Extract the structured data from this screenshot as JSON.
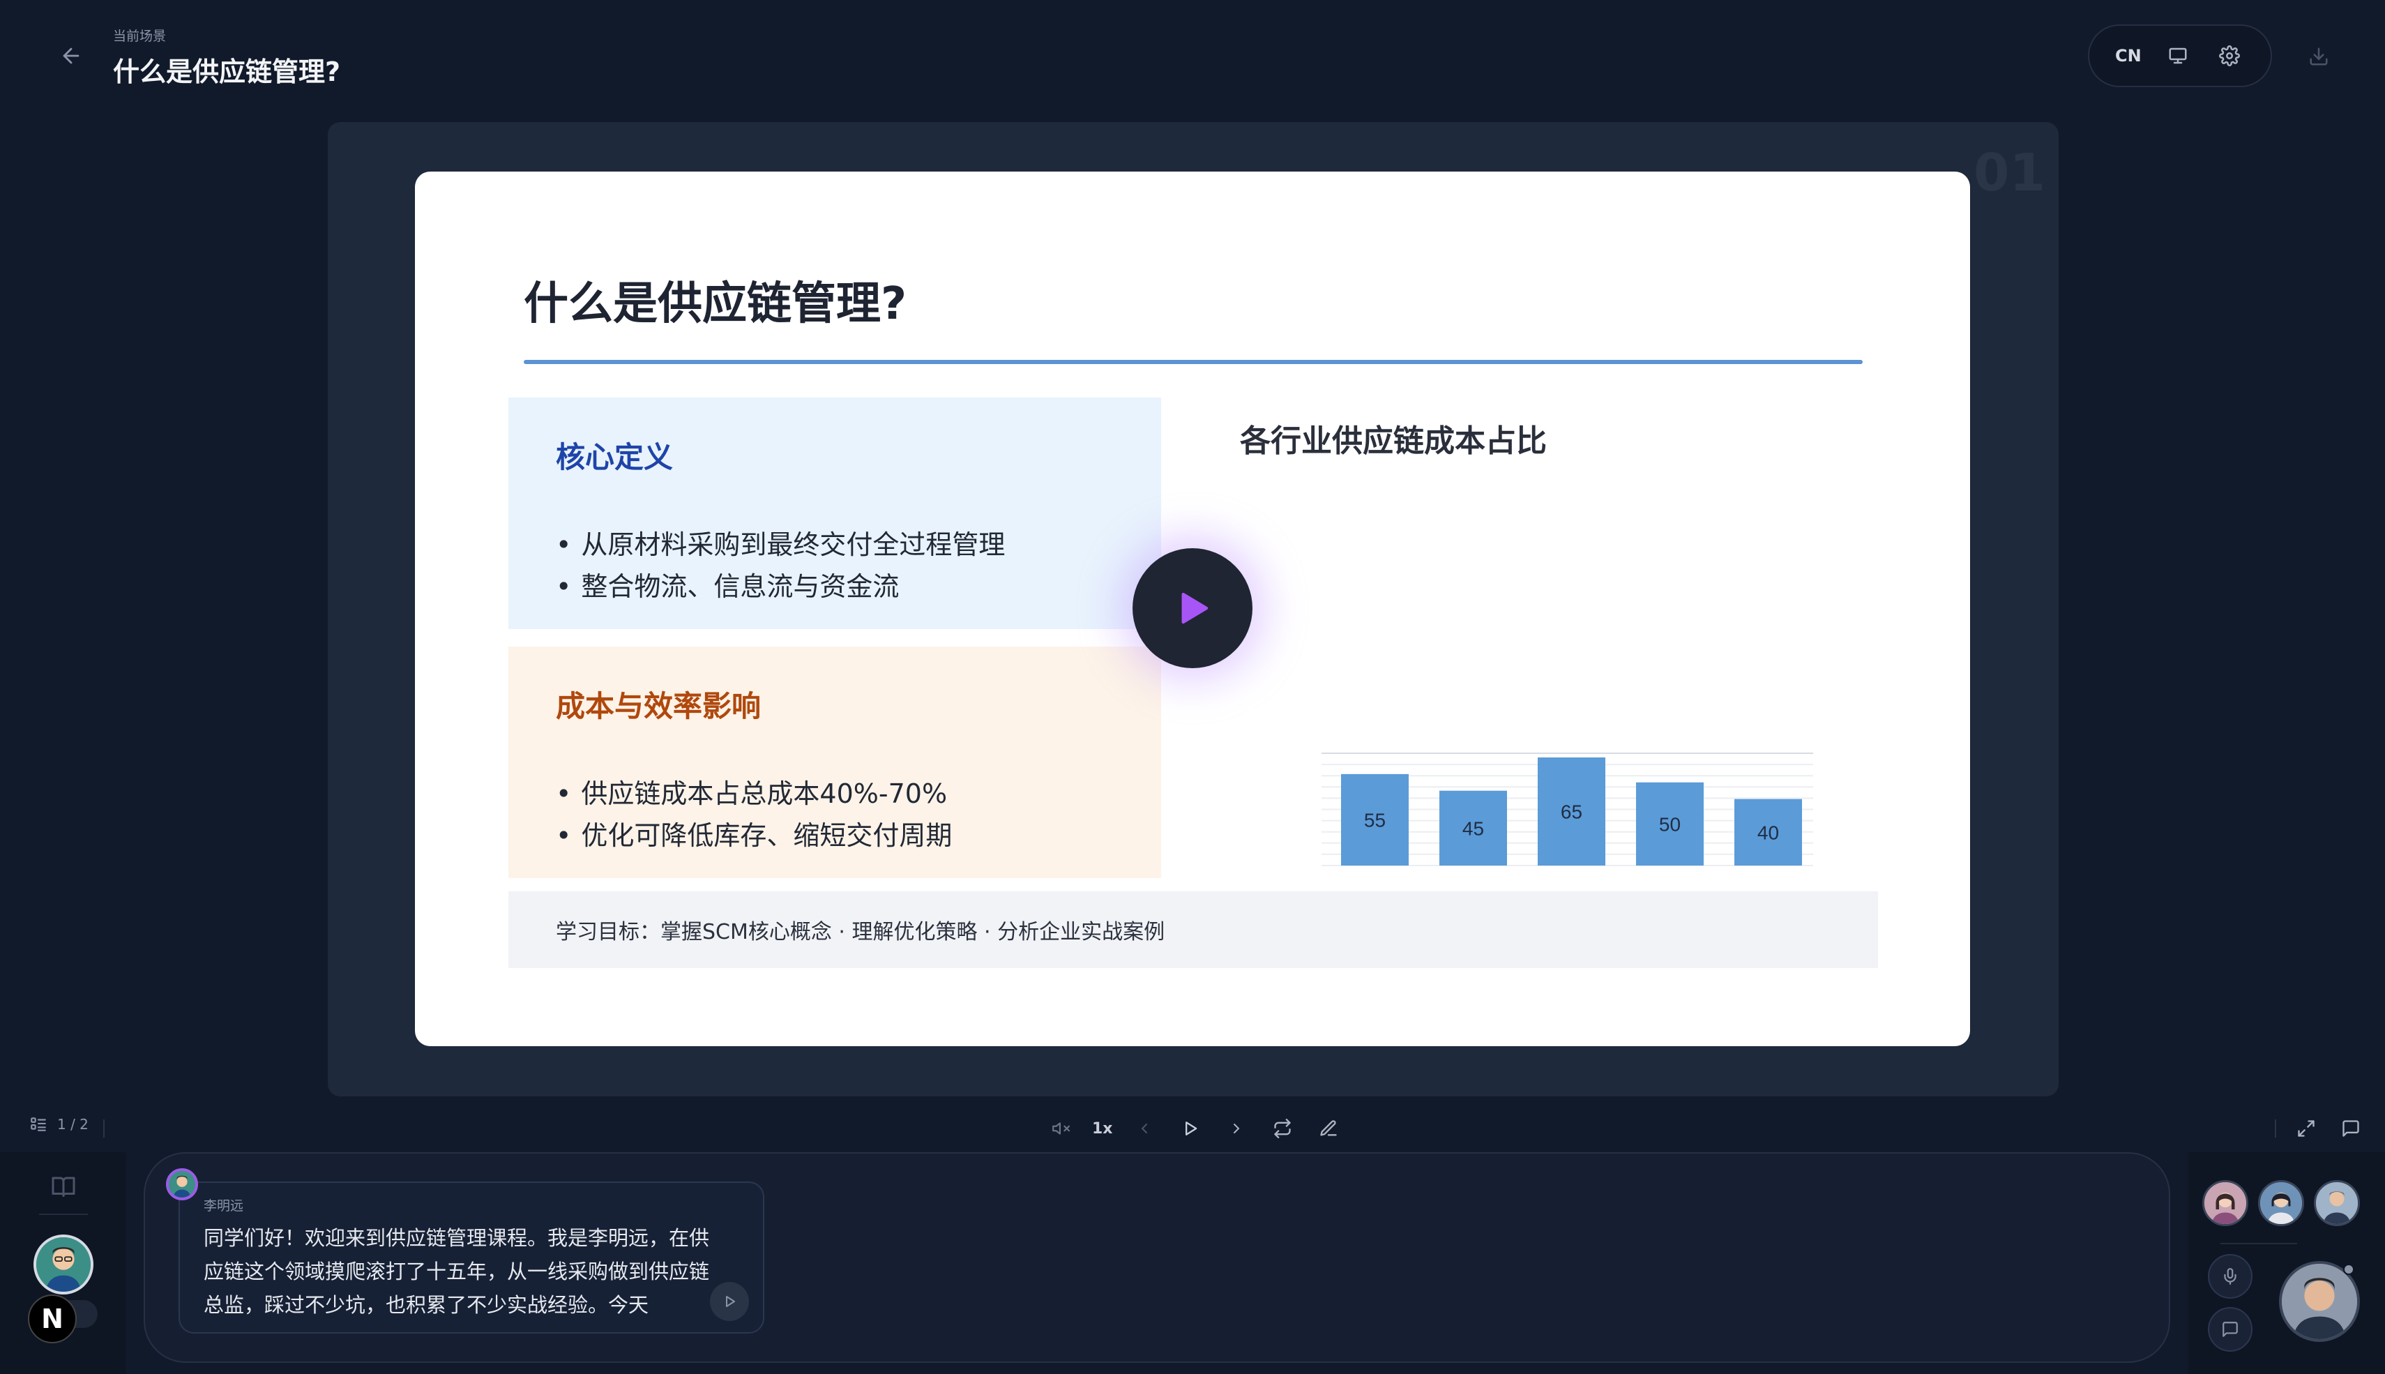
{
  "header": {
    "scene_label": "当前场景",
    "scene_title": "什么是供应链管理?",
    "lang": "CN"
  },
  "slide": {
    "number": "01",
    "title": "什么是供应链管理?",
    "cards": [
      {
        "heading": "核心定义",
        "bullets": [
          "从原材料采购到最终交付全过程管理",
          "整合物流、信息流与资金流"
        ]
      },
      {
        "heading": "成本与效率影响",
        "bullets": [
          "供应链成本占总成本40%-70%",
          "优化可降低库存、缩短交付周期"
        ]
      }
    ],
    "chart_title": "各行业供应链成本占比",
    "goal": "学习目标：掌握SCM核心概念 · 理解优化策略 · 分析企业实战案例"
  },
  "chart_data": {
    "type": "bar",
    "title": "各行业供应链成本占比",
    "categories": [
      "",
      "",
      "",
      "",
      ""
    ],
    "values": [
      55,
      45,
      65,
      50,
      40
    ],
    "ylim": [
      0,
      65
    ],
    "grid": true,
    "bar_color": "#5b9bd8",
    "data_labels": [
      "55",
      "45",
      "65",
      "50",
      "40"
    ]
  },
  "controls": {
    "page_indicator": "1 / 2",
    "speed": "1x"
  },
  "chat": {
    "speaker": "李明远",
    "message": "同学们好！欢迎来到供应链管理课程。我是李明远，在供应链这个领域摸爬滚打了十五年，从一线采购做到供应链总监，踩过不少坑，也积累了不少实战经验。今天"
  },
  "rail": {
    "logo_letter": "N"
  },
  "colors": {
    "background": "#111a2b",
    "stage": "#1e293b",
    "accent_blue": "#5b93d3",
    "card_blue": "#e8f3fd",
    "card_orange": "#fdf3e8",
    "play_accent": "#a855f7"
  }
}
